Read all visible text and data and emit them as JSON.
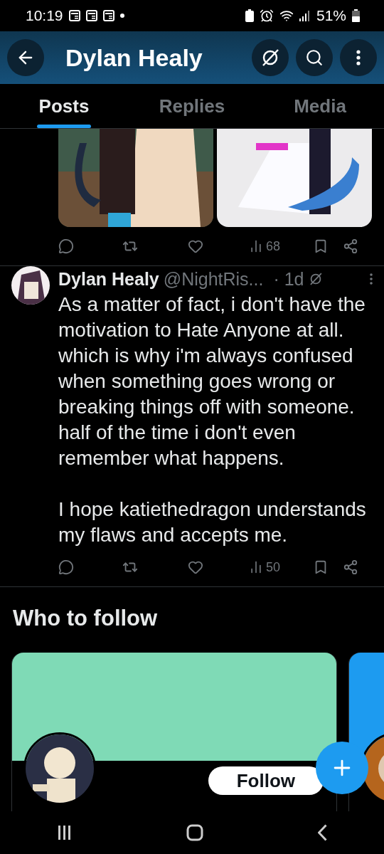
{
  "status_bar": {
    "time": "10:19",
    "battery": "51%"
  },
  "header": {
    "title": "Dylan Healy"
  },
  "tabs": [
    {
      "label": "Posts",
      "selected": true
    },
    {
      "label": "Replies",
      "selected": false
    },
    {
      "label": "Media",
      "selected": false
    }
  ],
  "posts": [
    {
      "kind": "media",
      "views": "68"
    },
    {
      "kind": "text",
      "author": "Dylan Healy",
      "handle": "@NightRis...",
      "time": "· 1d",
      "paragraphs": [
        "As a matter of fact, i don't have the motivation to Hate Anyone at all. which is why i'm always confused when something goes wrong or breaking things off with someone. half of the time i don't even remember what happens.",
        "I hope katiethedragon understands my flaws and accepts me."
      ],
      "views": "50"
    }
  ],
  "who_to_follow": {
    "title": "Who to follow",
    "cards": [
      {
        "color": "#7fdab6",
        "follow": "Follow"
      },
      {
        "color": "#1d9bf0"
      }
    ]
  }
}
